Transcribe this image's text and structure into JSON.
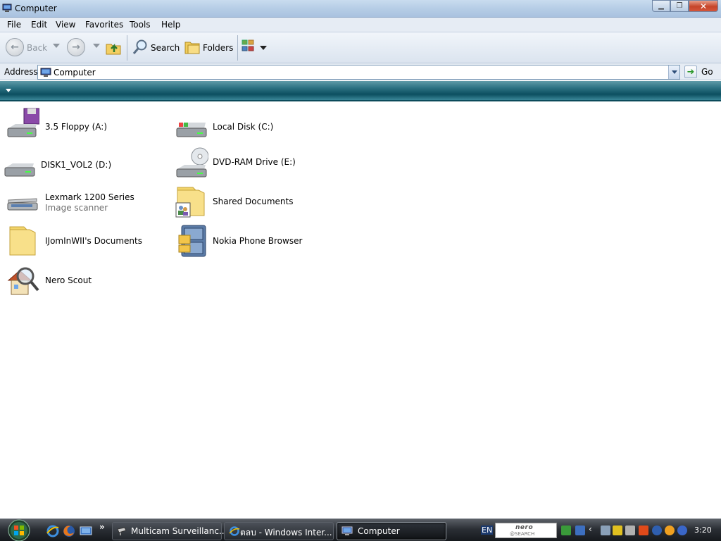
{
  "window": {
    "title": "Computer"
  },
  "menu": [
    "File",
    "Edit",
    "View",
    "Favorites",
    "Tools",
    "Help"
  ],
  "toolbar": {
    "back_label": "Back",
    "search_label": "Search",
    "folders_label": "Folders"
  },
  "address": {
    "label": "Address",
    "value": "Computer",
    "go_label": "Go"
  },
  "items": [
    {
      "name": "3.5 Floppy (A:)",
      "icon": "floppy-drive-icon"
    },
    {
      "name": "Local Disk (C:)",
      "icon": "windows-disk-icon"
    },
    {
      "name": "DISK1_VOL2 (D:)",
      "icon": "hard-disk-icon"
    },
    {
      "name": "DVD-RAM Drive (E:)",
      "icon": "dvd-drive-icon"
    },
    {
      "name": "Lexmark 1200 Series",
      "sub": "Image scanner",
      "icon": "scanner-icon"
    },
    {
      "name": "Shared Documents",
      "icon": "shared-folder-icon"
    },
    {
      "name": "IJomInWII's Documents",
      "icon": "folder-icon"
    },
    {
      "name": "Nokia Phone Browser",
      "icon": "nokia-cabinet-icon"
    },
    {
      "name": "Nero Scout",
      "icon": "nero-scout-icon"
    }
  ],
  "taskbar": {
    "tasks": [
      {
        "label": "Multicam Surveillanc...",
        "icon": "camera-icon"
      },
      {
        "label": "ตลบ - Windows Inter...",
        "icon": "ie-icon"
      },
      {
        "label": "Computer",
        "icon": "computer-icon"
      }
    ],
    "lang": "EN",
    "nero_text": "nero",
    "nero_sub": "@SEARCH",
    "clock": "3:20"
  }
}
